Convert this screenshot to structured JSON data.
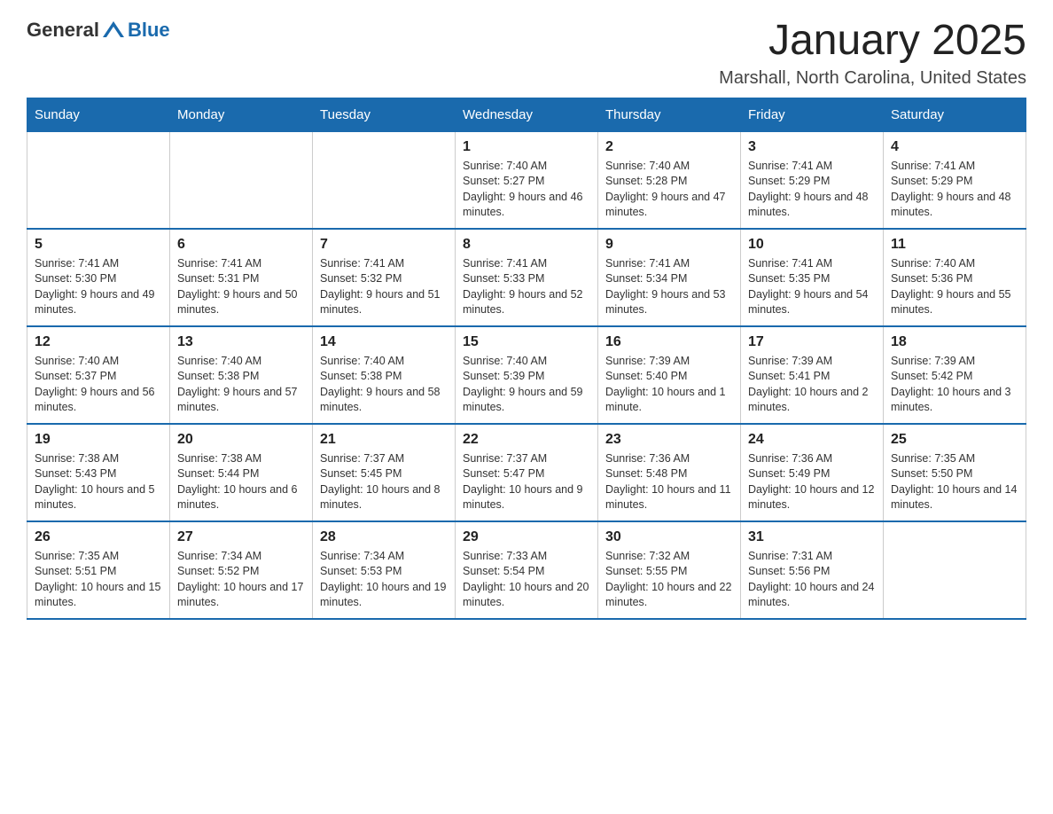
{
  "header": {
    "logo_general": "General",
    "logo_blue": "Blue",
    "title": "January 2025",
    "subtitle": "Marshall, North Carolina, United States"
  },
  "weekdays": [
    "Sunday",
    "Monday",
    "Tuesday",
    "Wednesday",
    "Thursday",
    "Friday",
    "Saturday"
  ],
  "weeks": [
    [
      {
        "day": "",
        "info": ""
      },
      {
        "day": "",
        "info": ""
      },
      {
        "day": "",
        "info": ""
      },
      {
        "day": "1",
        "info": "Sunrise: 7:40 AM\nSunset: 5:27 PM\nDaylight: 9 hours and 46 minutes."
      },
      {
        "day": "2",
        "info": "Sunrise: 7:40 AM\nSunset: 5:28 PM\nDaylight: 9 hours and 47 minutes."
      },
      {
        "day": "3",
        "info": "Sunrise: 7:41 AM\nSunset: 5:29 PM\nDaylight: 9 hours and 48 minutes."
      },
      {
        "day": "4",
        "info": "Sunrise: 7:41 AM\nSunset: 5:29 PM\nDaylight: 9 hours and 48 minutes."
      }
    ],
    [
      {
        "day": "5",
        "info": "Sunrise: 7:41 AM\nSunset: 5:30 PM\nDaylight: 9 hours and 49 minutes."
      },
      {
        "day": "6",
        "info": "Sunrise: 7:41 AM\nSunset: 5:31 PM\nDaylight: 9 hours and 50 minutes."
      },
      {
        "day": "7",
        "info": "Sunrise: 7:41 AM\nSunset: 5:32 PM\nDaylight: 9 hours and 51 minutes."
      },
      {
        "day": "8",
        "info": "Sunrise: 7:41 AM\nSunset: 5:33 PM\nDaylight: 9 hours and 52 minutes."
      },
      {
        "day": "9",
        "info": "Sunrise: 7:41 AM\nSunset: 5:34 PM\nDaylight: 9 hours and 53 minutes."
      },
      {
        "day": "10",
        "info": "Sunrise: 7:41 AM\nSunset: 5:35 PM\nDaylight: 9 hours and 54 minutes."
      },
      {
        "day": "11",
        "info": "Sunrise: 7:40 AM\nSunset: 5:36 PM\nDaylight: 9 hours and 55 minutes."
      }
    ],
    [
      {
        "day": "12",
        "info": "Sunrise: 7:40 AM\nSunset: 5:37 PM\nDaylight: 9 hours and 56 minutes."
      },
      {
        "day": "13",
        "info": "Sunrise: 7:40 AM\nSunset: 5:38 PM\nDaylight: 9 hours and 57 minutes."
      },
      {
        "day": "14",
        "info": "Sunrise: 7:40 AM\nSunset: 5:38 PM\nDaylight: 9 hours and 58 minutes."
      },
      {
        "day": "15",
        "info": "Sunrise: 7:40 AM\nSunset: 5:39 PM\nDaylight: 9 hours and 59 minutes."
      },
      {
        "day": "16",
        "info": "Sunrise: 7:39 AM\nSunset: 5:40 PM\nDaylight: 10 hours and 1 minute."
      },
      {
        "day": "17",
        "info": "Sunrise: 7:39 AM\nSunset: 5:41 PM\nDaylight: 10 hours and 2 minutes."
      },
      {
        "day": "18",
        "info": "Sunrise: 7:39 AM\nSunset: 5:42 PM\nDaylight: 10 hours and 3 minutes."
      }
    ],
    [
      {
        "day": "19",
        "info": "Sunrise: 7:38 AM\nSunset: 5:43 PM\nDaylight: 10 hours and 5 minutes."
      },
      {
        "day": "20",
        "info": "Sunrise: 7:38 AM\nSunset: 5:44 PM\nDaylight: 10 hours and 6 minutes."
      },
      {
        "day": "21",
        "info": "Sunrise: 7:37 AM\nSunset: 5:45 PM\nDaylight: 10 hours and 8 minutes."
      },
      {
        "day": "22",
        "info": "Sunrise: 7:37 AM\nSunset: 5:47 PM\nDaylight: 10 hours and 9 minutes."
      },
      {
        "day": "23",
        "info": "Sunrise: 7:36 AM\nSunset: 5:48 PM\nDaylight: 10 hours and 11 minutes."
      },
      {
        "day": "24",
        "info": "Sunrise: 7:36 AM\nSunset: 5:49 PM\nDaylight: 10 hours and 12 minutes."
      },
      {
        "day": "25",
        "info": "Sunrise: 7:35 AM\nSunset: 5:50 PM\nDaylight: 10 hours and 14 minutes."
      }
    ],
    [
      {
        "day": "26",
        "info": "Sunrise: 7:35 AM\nSunset: 5:51 PM\nDaylight: 10 hours and 15 minutes."
      },
      {
        "day": "27",
        "info": "Sunrise: 7:34 AM\nSunset: 5:52 PM\nDaylight: 10 hours and 17 minutes."
      },
      {
        "day": "28",
        "info": "Sunrise: 7:34 AM\nSunset: 5:53 PM\nDaylight: 10 hours and 19 minutes."
      },
      {
        "day": "29",
        "info": "Sunrise: 7:33 AM\nSunset: 5:54 PM\nDaylight: 10 hours and 20 minutes."
      },
      {
        "day": "30",
        "info": "Sunrise: 7:32 AM\nSunset: 5:55 PM\nDaylight: 10 hours and 22 minutes."
      },
      {
        "day": "31",
        "info": "Sunrise: 7:31 AM\nSunset: 5:56 PM\nDaylight: 10 hours and 24 minutes."
      },
      {
        "day": "",
        "info": ""
      }
    ]
  ]
}
